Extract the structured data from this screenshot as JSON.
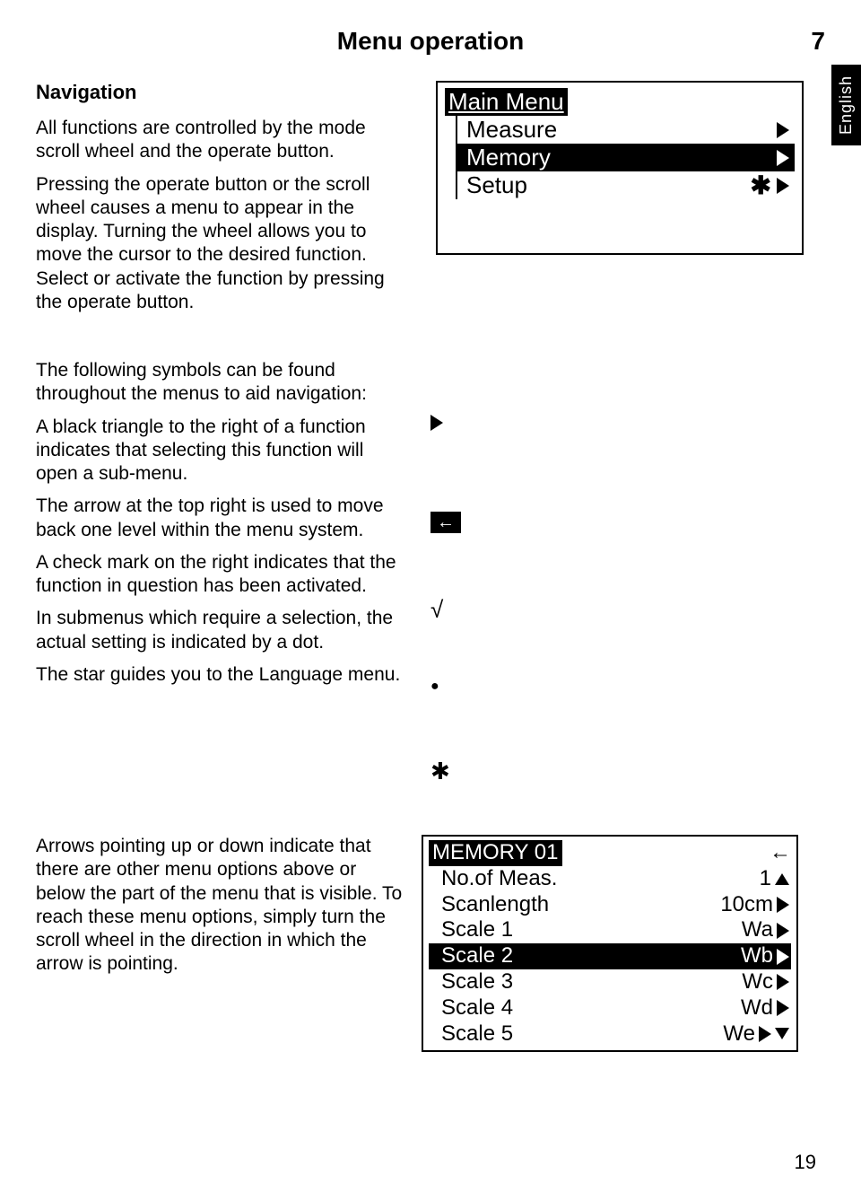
{
  "header": {
    "title": "Menu operation",
    "chapter": "7"
  },
  "lang_tab": "English",
  "section1": {
    "title": "Navigation",
    "p1": "All functions are controlled by the mode scroll wheel and the operate button.",
    "p2": "Pressing the operate button or the scroll wheel causes a menu to appear in the display. Turning the wheel allows you to move the cursor to the desired function. Select or activate the function by pressing the operate button."
  },
  "main_menu": {
    "title": "Main Menu",
    "items": [
      {
        "label": "Measure",
        "selected": false,
        "star": false
      },
      {
        "label": "Memory",
        "selected": true,
        "star": false
      },
      {
        "label": "Setup",
        "selected": false,
        "star": true
      }
    ]
  },
  "section2": {
    "intro": "The following symbols can be found throughout the menus to aid navigation:",
    "p_triangle": "A black triangle to the right of a function indicates that selecting this function will open a sub-menu.",
    "p_arrow": "The arrow at the top right is used to move back one level within the menu system.",
    "p_check": "A check mark on the right indicates that the function in question has been activated.",
    "p_dot": "In submenus which require a selection, the actual setting is indicated by a dot.",
    "p_star": "The star guides you to the Language menu."
  },
  "symbols": {
    "check": "√",
    "dot": "●",
    "star": "✱",
    "back_arrow": "←",
    "left_arrow": "←"
  },
  "section3": {
    "p1": "Arrows pointing up or down indicate that there are other menu options above or below the part of the menu that is visible. To reach these menu options, simply turn the scroll wheel in the direction in which the arrow is pointing."
  },
  "memory_menu": {
    "title": "MEMORY 01",
    "rows": [
      {
        "label": "No.of Meas.",
        "value": "1",
        "arrow_up": true,
        "selected": false
      },
      {
        "label": "Scanlength",
        "value": "10cm",
        "selected": false
      },
      {
        "label": "Scale  1",
        "value": "Wa",
        "selected": false
      },
      {
        "label": "Scale  2",
        "value": "Wb",
        "selected": true
      },
      {
        "label": "Scale  3",
        "value": "Wc",
        "selected": false
      },
      {
        "label": "Scale  4",
        "value": "Wd",
        "selected": false
      },
      {
        "label": "Scale  5",
        "value": "We",
        "arrow_down": true,
        "selected": false
      }
    ]
  },
  "page_number": "19"
}
